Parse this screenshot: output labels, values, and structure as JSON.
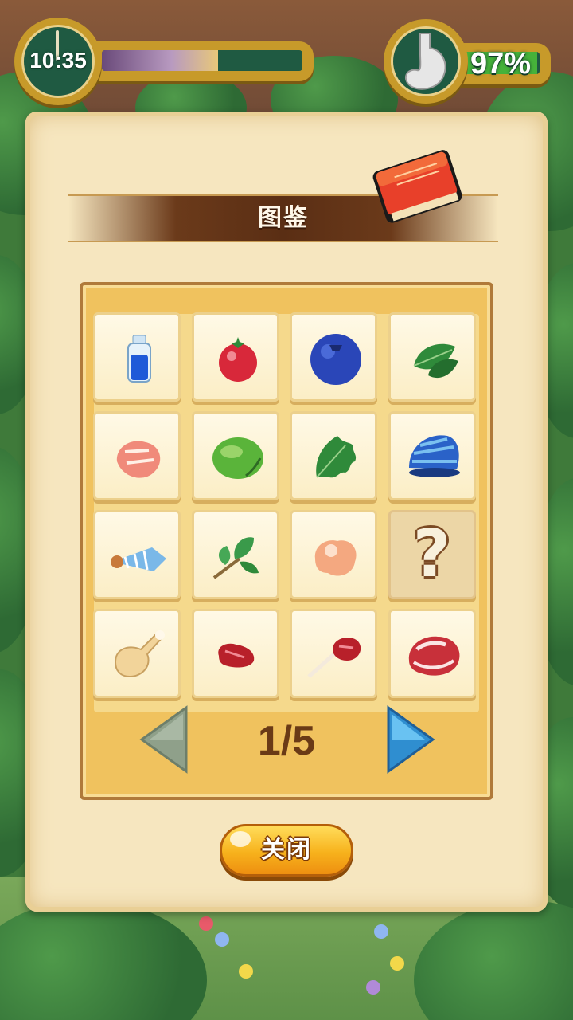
{
  "hud": {
    "time": "10:35",
    "time_progress": 0.58,
    "fullness_text": "97%",
    "fullness": 0.97,
    "clock_icon": "clock-icon",
    "stomach_icon": "stomach-icon"
  },
  "encyclopedia": {
    "title": "图鉴",
    "title_icon": "red-book-icon",
    "items": [
      {
        "name": "water-bottle",
        "discovered": true
      },
      {
        "name": "red-berry",
        "discovered": true
      },
      {
        "name": "blueberry",
        "discovered": true
      },
      {
        "name": "spinach-leaf",
        "discovered": true
      },
      {
        "name": "raw-meat-chunk",
        "discovered": true
      },
      {
        "name": "green-fruit",
        "discovered": true
      },
      {
        "name": "oak-leaf",
        "discovered": true
      },
      {
        "name": "blue-shell",
        "discovered": true
      },
      {
        "name": "cone-shell",
        "discovered": true
      },
      {
        "name": "herb-sprig",
        "discovered": true
      },
      {
        "name": "pink-nugget",
        "discovered": true
      },
      {
        "name": "unknown",
        "discovered": false,
        "label": "?"
      },
      {
        "name": "chicken-drumstick",
        "discovered": true
      },
      {
        "name": "small-red-meat",
        "discovered": true
      },
      {
        "name": "lamb-chop",
        "discovered": true
      },
      {
        "name": "steak",
        "discovered": true
      }
    ],
    "page_text": "1/5",
    "prev_icon": "left-arrow-icon",
    "next_icon": "right-arrow-icon",
    "close_label": "关闭"
  },
  "colors": {
    "parchment": "#f6e6bf",
    "banner": "#5a2e14",
    "grid_bg": "#f0c25e",
    "button": "#f7b21c",
    "next_arrow": "#3a9ed8",
    "prev_arrow_disabled": "#8fa08a"
  }
}
